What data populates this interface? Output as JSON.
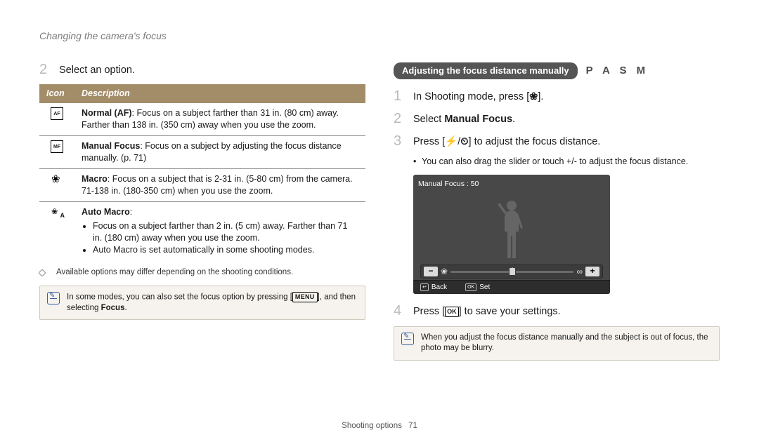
{
  "running_head": "Changing the camera's focus",
  "left": {
    "step2_num": "2",
    "step2_text": "Select an option.",
    "table": {
      "header_icon": "Icon",
      "header_desc": "Description",
      "rows": [
        {
          "icon_label": "AF",
          "lead": "Normal (AF)",
          "body": ": Focus on a subject farther than 31 in. (80 cm) away. Farther than 138 in. (350 cm) away when you use the zoom."
        },
        {
          "icon_label": "MF",
          "lead": "Manual Focus",
          "body": ": Focus on a subject by adjusting the focus distance manually. (p. 71)"
        },
        {
          "icon_label": "macro",
          "lead": "Macro",
          "body": ": Focus on a subject that is 2-31 in. (5-80 cm) from the camera. 71-138 in. (180-350 cm) when you use the zoom."
        },
        {
          "icon_label": "auto-macro",
          "lead": "Auto Macro",
          "body_lines": [
            "Focus on a subject farther than 2 in. (5 cm) away. Farther than 71 in. (180 cm) away when you use the zoom.",
            "Auto Macro is set automatically in some shooting modes."
          ]
        }
      ]
    },
    "smallprint": "Available options may differ depending on the shooting conditions.",
    "note_pre": "In some modes, you can also set the focus option by pressing [",
    "note_menu": "MENU",
    "note_mid": "], and then selecting ",
    "note_bold": "Focus",
    "note_post": "."
  },
  "right": {
    "badge": "Adjusting the focus distance manually",
    "modes": "P A S M",
    "step1_num": "1",
    "step1_pre": "In Shooting mode, press [",
    "step1_glyph": "❀",
    "step1_post": "].",
    "step2_num": "2",
    "step2_pre": "Select ",
    "step2_bold": "Manual Focus",
    "step2_post": ".",
    "step3_num": "3",
    "step3_pre": "Press [",
    "step3_g1": "⚡",
    "step3_slash": "/",
    "step3_g2": "⏲",
    "step3_post": "] to adjust the focus distance.",
    "step3_bullet": "You can also drag the slider or touch +/- to adjust the focus distance.",
    "lcd": {
      "title": "Manual Focus : 50",
      "minus": "−",
      "plus": "+",
      "back_key": "↩",
      "back_label": "Back",
      "set_key": "OK",
      "set_label": "Set"
    },
    "step4_num": "4",
    "step4_pre": "Press [",
    "step4_key": "OK",
    "step4_post": "] to save your settings.",
    "note": "When you adjust the focus distance manually and the subject is out of focus, the photo may be blurry."
  },
  "footer": {
    "section": "Shooting options",
    "page": "71"
  }
}
